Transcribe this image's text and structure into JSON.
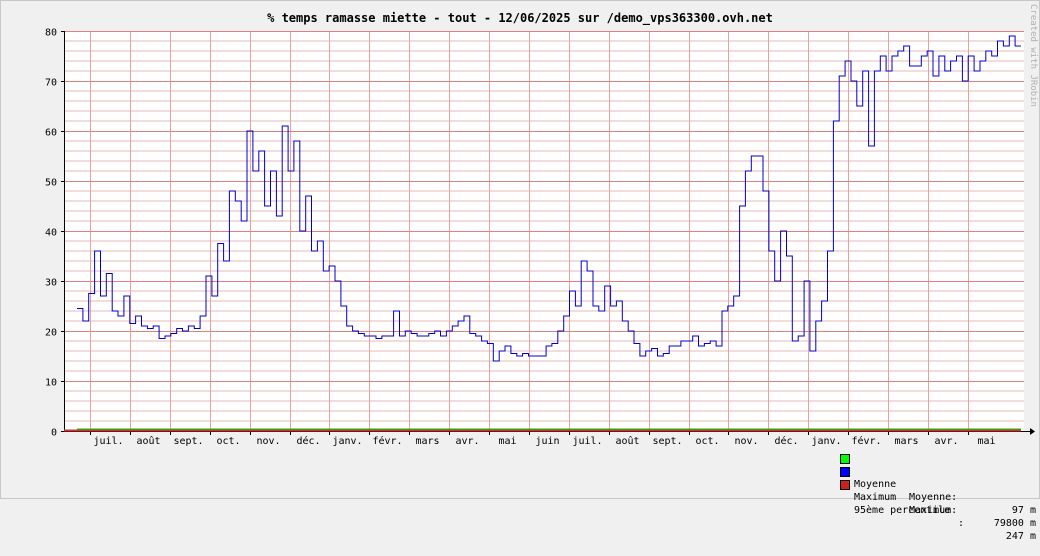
{
  "chart_data": {
    "type": "line",
    "title": "% temps ramasse miette - tout - 12/06/2025 sur /demo_vps363300.ovh.net",
    "watermark": "Created with JRobin",
    "ylim": [
      0,
      80
    ],
    "yticks": [
      0,
      10,
      20,
      30,
      40,
      50,
      60,
      70,
      80
    ],
    "x_months": [
      "juil.",
      "août",
      "sept.",
      "oct.",
      "nov.",
      "déc.",
      "janv.",
      "févr.",
      "mars",
      "avr.",
      "mai",
      "juin",
      "juil.",
      "août",
      "sept.",
      "oct.",
      "nov.",
      "déc.",
      "janv.",
      "févr.",
      "mars",
      "avr.",
      "mai"
    ],
    "series": [
      {
        "name": "Maximum",
        "color": "#0000cc",
        "x_index_range": [
          0,
          100
        ],
        "values": [
          24.5,
          22,
          27.5,
          36,
          27,
          31.5,
          24,
          23,
          27,
          21.5,
          23,
          21,
          20.5,
          21,
          18.5,
          19,
          19.5,
          20.5,
          20,
          21,
          20.5,
          23,
          31,
          27,
          37.5,
          34,
          48,
          46,
          42,
          60,
          52,
          56,
          45,
          52,
          43,
          61,
          52,
          58,
          40,
          47,
          36,
          38,
          32,
          33,
          30,
          25,
          21,
          20,
          19.5,
          19,
          19,
          18.5,
          19,
          19,
          24,
          19,
          20,
          19.5,
          19,
          19,
          19.5,
          20,
          19,
          20,
          21,
          22,
          23,
          19.5,
          19,
          18,
          17.5,
          14,
          16,
          17,
          15.5,
          15,
          15.5,
          15,
          15,
          15,
          17,
          17.5,
          20,
          23,
          28,
          25,
          34,
          32,
          25,
          24,
          29,
          25,
          26,
          22,
          20,
          17.5,
          15,
          16,
          16.5,
          15,
          15.5,
          17,
          17,
          18,
          18,
          19,
          17,
          17.5,
          18,
          17,
          24,
          25,
          27,
          45,
          52,
          55,
          55,
          48,
          36,
          30,
          40,
          35,
          18,
          19,
          30,
          16,
          22,
          26,
          36,
          62,
          71,
          74,
          70,
          65,
          72,
          57,
          72,
          75,
          72,
          75,
          76,
          77,
          73,
          73,
          75,
          76,
          71,
          75,
          72,
          74,
          75,
          70,
          75,
          72,
          74,
          76,
          75,
          78,
          77,
          79,
          77
        ]
      },
      {
        "name": "Moyenne",
        "color": "#00cc00",
        "values": [
          0.3
        ]
      },
      {
        "name": "95ème percentile",
        "color": "#cc3333",
        "values": [
          0.2
        ]
      }
    ],
    "legend": [
      {
        "name": "Moyenne",
        "label": "Moyenne:",
        "value": "97 m",
        "color": "#00ff00"
      },
      {
        "name": "Maximum",
        "label": "Maximum:",
        "value": "79800 m",
        "color": "#0000ff"
      },
      {
        "name": "95ème percentile",
        "label": ":",
        "value": "247 m",
        "color": "#cc2020"
      }
    ],
    "grid": true,
    "legend_placement": "bottom-right"
  }
}
